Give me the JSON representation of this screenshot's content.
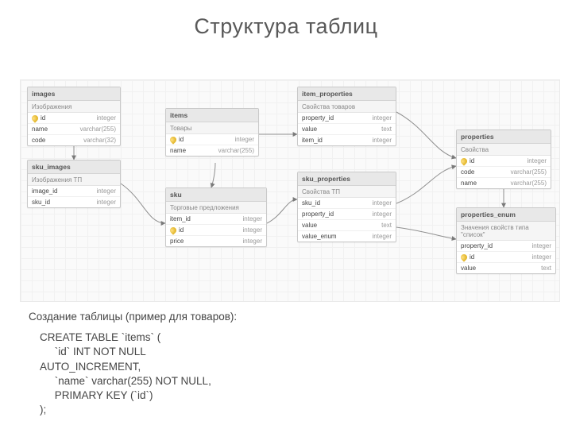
{
  "title": "Структура таблиц",
  "canvas": {
    "tables": {
      "images": {
        "name": "images",
        "label": "Изображения",
        "cols": [
          {
            "n": "id",
            "t": "integer",
            "pk": true
          },
          {
            "n": "name",
            "t": "varchar(255)"
          },
          {
            "n": "code",
            "t": "varchar(32)"
          }
        ]
      },
      "sku_images": {
        "name": "sku_images",
        "label": "Изображения ТП",
        "cols": [
          {
            "n": "image_id",
            "t": "integer"
          },
          {
            "n": "sku_id",
            "t": "integer"
          }
        ]
      },
      "items": {
        "name": "items",
        "label": "Товары",
        "cols": [
          {
            "n": "id",
            "t": "integer",
            "pk": true
          },
          {
            "n": "name",
            "t": "varchar(255)"
          }
        ]
      },
      "sku": {
        "name": "sku",
        "label": "Торговые предложения",
        "cols": [
          {
            "n": "item_id",
            "t": "integer"
          },
          {
            "n": "id",
            "t": "integer",
            "pk": true
          },
          {
            "n": "price",
            "t": "integer"
          }
        ]
      },
      "item_props": {
        "name": "item_properties",
        "label": "Свойства товаров",
        "cols": [
          {
            "n": "property_id",
            "t": "integer"
          },
          {
            "n": "value",
            "t": "text"
          },
          {
            "n": "item_id",
            "t": "integer"
          }
        ]
      },
      "sku_props": {
        "name": "sku_properties",
        "label": "Свойства ТП",
        "cols": [
          {
            "n": "sku_id",
            "t": "integer"
          },
          {
            "n": "property_id",
            "t": "integer"
          },
          {
            "n": "value",
            "t": "text"
          },
          {
            "n": "value_enum",
            "t": "integer"
          }
        ]
      },
      "properties": {
        "name": "properties",
        "label": "Свойства",
        "cols": [
          {
            "n": "id",
            "t": "integer",
            "pk": true
          },
          {
            "n": "code",
            "t": "varchar(255)"
          },
          {
            "n": "name",
            "t": "varchar(255)"
          }
        ]
      },
      "prop_enum": {
        "name": "properties_enum",
        "label": "Значения свойств типа \"список\"",
        "cols": [
          {
            "n": "property_id",
            "t": "integer"
          },
          {
            "n": "id",
            "t": "integer",
            "pk": true
          },
          {
            "n": "value",
            "t": "text"
          }
        ]
      }
    },
    "relations": [
      {
        "from": "images",
        "to": "sku_images"
      },
      {
        "from": "sku_images",
        "to": "sku"
      },
      {
        "from": "items",
        "to": "sku"
      },
      {
        "from": "items",
        "to": "item_props"
      },
      {
        "from": "sku",
        "to": "sku_props"
      },
      {
        "from": "item_props",
        "to": "properties"
      },
      {
        "from": "sku_props",
        "to": "properties"
      },
      {
        "from": "sku_props",
        "to": "prop_enum"
      },
      {
        "from": "properties",
        "to": "prop_enum"
      }
    ]
  },
  "footer_caption": "Создание таблицы (пример для товаров):",
  "sql": "CREATE TABLE `items` (\n     `id` INT NOT NULL\nAUTO_INCREMENT,\n     `name` varchar(255) NOT NULL,\n     PRIMARY KEY (`id`)\n);"
}
